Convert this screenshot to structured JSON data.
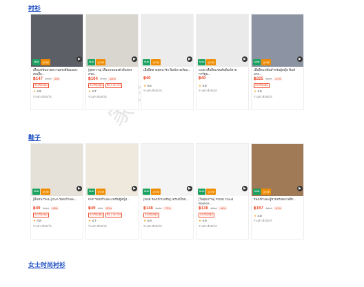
{
  "sections": {
    "shirts": {
      "title": "衬衫"
    },
    "shoes": {
      "title": "鞋子"
    },
    "women": {
      "title": "女士时尚衬衫"
    }
  },
  "watermark": "家学",
  "tag_a": "Mall",
  "tag_b": "ถูกสุด",
  "shirts": [
    {
      "title": "เสื้อแฟชั่นลายหวานตรงสีย้อมและคอเสื้อ...",
      "price": "฿147",
      "old": "฿185",
      "disc": "-5%",
      "b1": "ส่งฟรีสุดคุ้ม",
      "b2": "",
      "rating": "4.9",
      "shop": "ร้านค้าเชื่อถือได้",
      "img": "#5d5f66"
    },
    {
      "title": "[สุดหวาน] เสื้อแขนพองตัวสั้นทรงสวย...",
      "price": "฿104",
      "old": "฿130",
      "disc": "-20%",
      "b1": "ส่งฟรีสุดคุ้ม",
      "b2": "ซื้อ 2 ลด 3%",
      "rating": "4.7",
      "shop": "ร้านค้าเชื่อถือได้",
      "img": "#d9d6cf"
    },
    {
      "title": "เสื้อยืดลายสุดน่ารัก พิมพ์ลายเรียบ...",
      "price": "฿40",
      "old": "",
      "disc": "",
      "b1": "",
      "b2": "",
      "rating": "4.8",
      "shop": "ร้านค้าเชื่อถือได้",
      "img": "#ececec"
    },
    {
      "title": "COD เสื้อยืดแขนสั้นพิมพ์ลายการ์ตูน...",
      "price": "฿40",
      "old": "",
      "disc": "",
      "b1": "",
      "b2": "",
      "rating": "4.8",
      "shop": "ร้านค้าเชื่อถือได้",
      "img": "#eaeaea"
    },
    {
      "title": "เสื้อยืดแฟชั่นสำหรับผู้หญิง พิมพ์ลาย...",
      "price": "฿225",
      "old": "฿280",
      "disc": "-17%",
      "b1": "ส่งฟรีสุดคุ้ม",
      "b2": "",
      "rating": "4.9",
      "shop": "ร้านค้าเชื่อถือได้",
      "img": "#8c93a3"
    }
  ],
  "shoes": [
    {
      "title": "[พื้นหนาระยะ] EVA รองเท้าแตะ...",
      "price": "฿49",
      "old": "฿119",
      "disc": "-59%",
      "b1": "ส่งฟรีสุดคุ้ม",
      "b2": "",
      "rating": "4.8",
      "shop": "ร้านค้าเชื่อถือได้",
      "img": "#e6e1d8"
    },
    {
      "title": "PAP รองเท้าแตะแฟชั่นผู้หญิง...",
      "price": "฿49",
      "old": "฿99",
      "disc": "-50%",
      "b1": "ส่งฟรีสุดคุ้ม",
      "b2": "ซื้อ 2 ลด 3%",
      "rating": "4.7",
      "shop": "ร้านค้าเชื่อถือได้",
      "img": "#efe8dc"
    },
    {
      "title": "[SNB รองเท้าแฟชั่น] เทรนด์ใหม่...",
      "price": "฿148",
      "old": "฿499",
      "disc": "-70%",
      "b1": "ส่งฟรีสุดคุ้ม",
      "b2": "",
      "rating": "4.9",
      "shop": "ร้านค้าเชื่อถือได้",
      "img": "#f4f4f4"
    },
    {
      "title": "[ในคุณภาพ] POSE Cloud Bounce...",
      "price": "฿138",
      "old": "฿260",
      "disc": "-46%",
      "b1": "ส่งฟรีสุดคุ้ม",
      "b2": "",
      "rating": "4.9",
      "shop": "ร้านค้าเชื่อถือได้",
      "img": "#f6f6f6"
    },
    {
      "title": "รองเท้าแตะผู้ชายทรงคลาสสิก...",
      "price": "฿157",
      "old": "฿400",
      "disc": "-61%",
      "b1": "",
      "b2": "",
      "rating": "4.8",
      "shop": "ร้านค้าเชื่อถือได้",
      "img": "#a07a57"
    }
  ],
  "colors": {
    "accent": "#1f4fc4",
    "price": "#ee4d2d",
    "tag_green": "#1ba260",
    "tag_orange": "#f08c00"
  }
}
